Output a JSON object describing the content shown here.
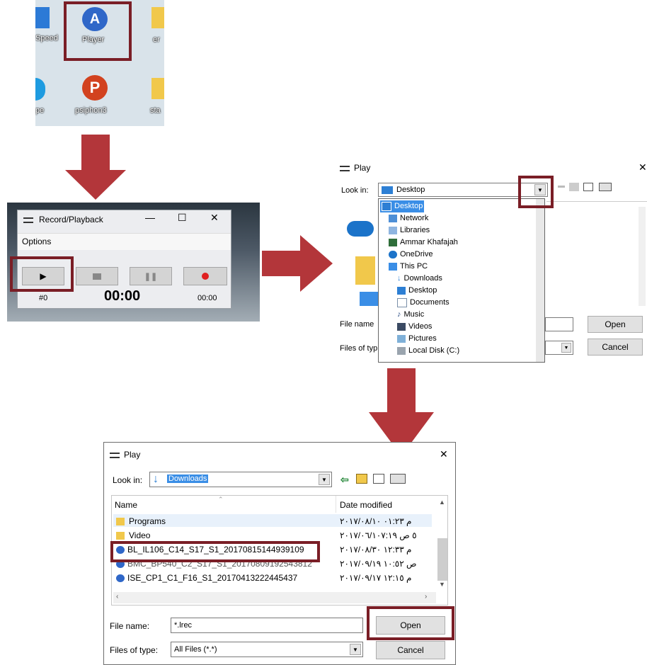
{
  "desktop": {
    "icons": [
      {
        "label": "Speed"
      },
      {
        "label": "Player"
      },
      {
        "label": "er"
      },
      {
        "label": "pe"
      },
      {
        "label": "psiphon3"
      },
      {
        "label": "sta"
      }
    ]
  },
  "recorder": {
    "title": "Record/Playback",
    "menu": "Options",
    "track": "#0",
    "time": "00:00",
    "duration": "00:00",
    "min_glyph": "—",
    "max_glyph": "☐",
    "close_glyph": "✕"
  },
  "play_dialog_1": {
    "title": "Play",
    "look_in_label": "Look in:",
    "look_in_value": "Desktop",
    "close_glyph": "✕",
    "dropdown_items": [
      {
        "label": "Desktop"
      },
      {
        "label": "Network"
      },
      {
        "label": "Libraries"
      },
      {
        "label": "Ammar Khafajah"
      },
      {
        "label": "OneDrive"
      },
      {
        "label": "This PC"
      },
      {
        "label": "Downloads"
      },
      {
        "label": "Desktop"
      },
      {
        "label": "Documents"
      },
      {
        "label": "Music"
      },
      {
        "label": "Videos"
      },
      {
        "label": "Pictures"
      },
      {
        "label": "Local Disk (C:)"
      }
    ],
    "file_name_label": "File name",
    "files_of_type_label": "Files of typ",
    "open_label": "Open",
    "cancel_label": "Cancel"
  },
  "play_dialog_2": {
    "title": "Play",
    "look_in_label": "Look in:",
    "look_in_value": "Downloads",
    "close_glyph": "✕",
    "col_name": "Name",
    "col_date": "Date modified",
    "rows": [
      {
        "name": "Programs",
        "date": "۲۰۱۷/۰۸/۱۰ م ۰۱:۲۳"
      },
      {
        "name": "Video",
        "date": "۲۰۱۷/۰٦/۱٥ ص ۰۷:۱۹"
      },
      {
        "name": "BL_IL106_C14_S17_S1_20170815144939109",
        "date": "۲۰۱۷/۰۸/۳۰ م ۱۲:۳۳"
      },
      {
        "name": "BMC_BP540_C2_S17_S1_20170809192543812",
        "date": "۲۰۱۷/۰۹/۱۹ ص ۱۰:٥۲"
      },
      {
        "name": "ISE_CP1_C1_F16_S1_20170413222445437",
        "date": "۲۰۱۷/۰۹/۱۷ م ۱۲:۱٥"
      }
    ],
    "file_name_label": "File name:",
    "file_name_value": "*.lrec",
    "files_of_type_label": "Files of type:",
    "files_of_type_value": "All Files (*.*)",
    "open_label": "Open",
    "cancel_label": "Cancel"
  },
  "colors": {
    "arrow": "#b3363a",
    "highlight": "#7a1e26",
    "select_blue": "#3a8ee6"
  }
}
